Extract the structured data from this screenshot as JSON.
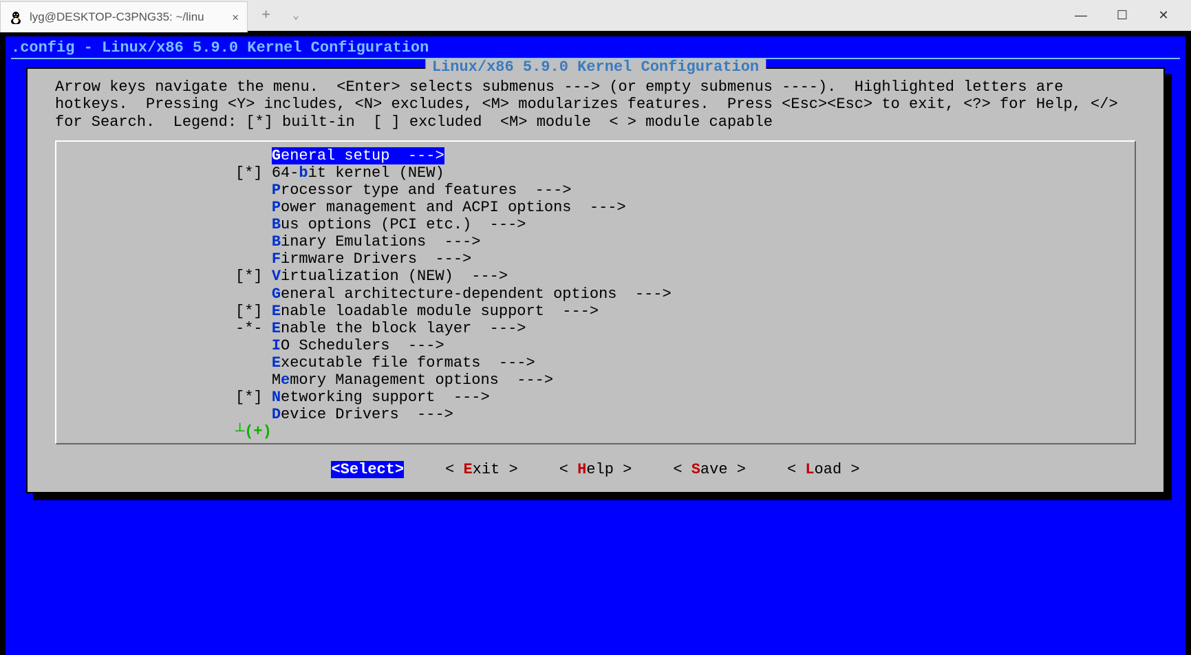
{
  "window": {
    "tab_title": "lyg@DESKTOP-C3PNG35: ~/linu",
    "minimize": "—",
    "maximize": "☐",
    "close": "✕"
  },
  "path": ".config - Linux/x86 5.9.0 Kernel Configuration",
  "dialog_title": " Linux/x86 5.9.0 Kernel Configuration ",
  "helptext": "Arrow keys navigate the menu.  <Enter> selects submenus ---> (or empty submenus ----).  Highlighted letters are hotkeys.  Pressing <Y> includes, <N> excludes, <M> modularizes features.  Press <Esc><Esc> to exit, <?> for Help, </> for Search.  Legend: [*] built-in  [ ] excluded  <M> module  < > module capable",
  "menu": [
    {
      "prefix": "    ",
      "pre": "",
      "hk": "G",
      "post": "eneral setup  --->",
      "selected": true
    },
    {
      "prefix": "[*] ",
      "pre": "64-",
      "hk": "b",
      "post": "it kernel (NEW)"
    },
    {
      "prefix": "    ",
      "pre": "",
      "hk": "P",
      "post": "rocessor type and features  --->"
    },
    {
      "prefix": "    ",
      "pre": "",
      "hk": "P",
      "post": "ower management and ACPI options  --->"
    },
    {
      "prefix": "    ",
      "pre": "",
      "hk": "B",
      "post": "us options (PCI etc.)  --->"
    },
    {
      "prefix": "    ",
      "pre": "",
      "hk": "B",
      "post": "inary Emulations  --->"
    },
    {
      "prefix": "    ",
      "pre": "",
      "hk": "F",
      "post": "irmware Drivers  --->"
    },
    {
      "prefix": "[*] ",
      "pre": "",
      "hk": "V",
      "post": "irtualization (NEW)  --->"
    },
    {
      "prefix": "    ",
      "pre": "",
      "hk": "G",
      "post": "eneral architecture-dependent options  --->"
    },
    {
      "prefix": "[*] ",
      "pre": "",
      "hk": "E",
      "post": "nable loadable module support  --->"
    },
    {
      "prefix": "-*- ",
      "pre": "",
      "hk": "E",
      "post": "nable the block layer  --->"
    },
    {
      "prefix": "    ",
      "pre": "",
      "hk": "I",
      "post": "O Schedulers  --->"
    },
    {
      "prefix": "    ",
      "pre": "",
      "hk": "E",
      "post": "xecutable file formats  --->"
    },
    {
      "prefix": "    ",
      "pre": "M",
      "hk": "e",
      "post": "mory Management options  --->"
    },
    {
      "prefix": "[*] ",
      "pre": "",
      "hk": "N",
      "post": "etworking support  --->"
    },
    {
      "prefix": "    ",
      "pre": "",
      "hk": "D",
      "post": "evice Drivers  --->"
    }
  ],
  "more": "┴(+)",
  "buttons": {
    "select": "<Select>",
    "exit_pre": "< ",
    "exit_hk": "E",
    "exit_post": "xit >",
    "help_pre": "< ",
    "help_hk": "H",
    "help_post": "elp >",
    "save_pre": "< ",
    "save_hk": "S",
    "save_post": "ave >",
    "load_pre": "< ",
    "load_hk": "L",
    "load_post": "oad >"
  }
}
